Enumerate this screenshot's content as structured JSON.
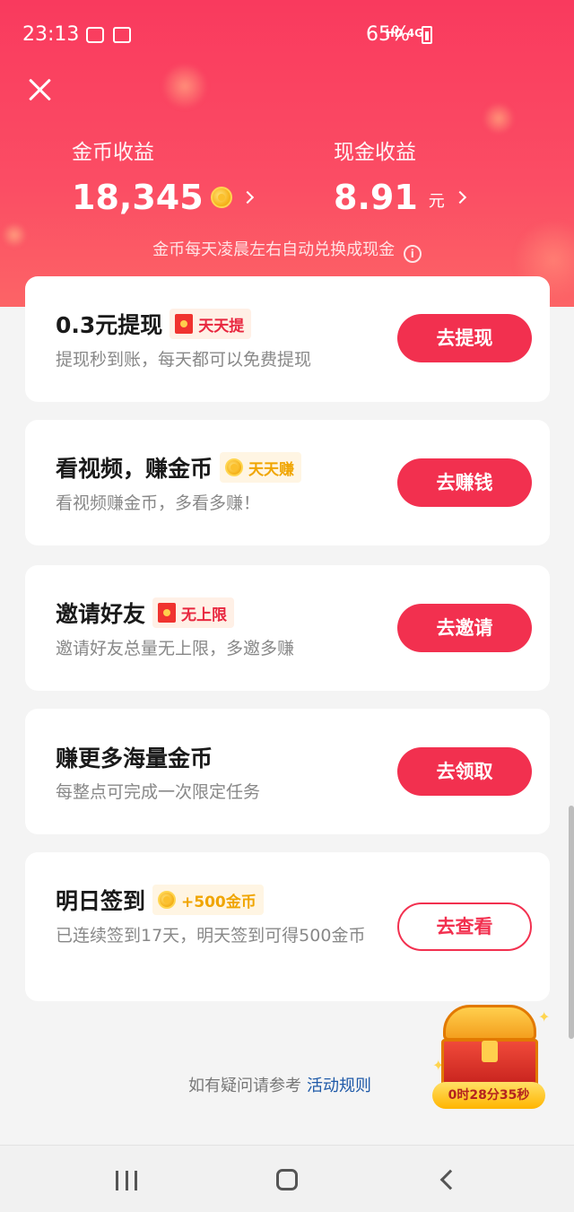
{
  "status_bar": {
    "time": "23:13",
    "network": "HD 4G",
    "battery": "65%"
  },
  "header": {
    "coin_label": "金币收益",
    "coin_value": "18,345",
    "cash_label": "现金收益",
    "cash_value": "8.91",
    "cash_unit": "元",
    "note": "金币每天凌晨左右自动兑换成现金",
    "colors": {
      "gradient_top": "#f93a5e",
      "gradient_bottom": "#fc6466"
    }
  },
  "tasks": [
    {
      "title": "0.3元提现",
      "tag": "天天提",
      "tag_icon": "red-envelope-icon",
      "desc": "提现秒到账，每天都可以免费提现",
      "button": "去提现",
      "button_style": "filled"
    },
    {
      "title": "看视频，赚金币",
      "tag": "天天赚",
      "tag_icon": "coin-icon",
      "desc": "看视频赚金币，多看多赚！",
      "button": "去赚钱",
      "button_style": "filled"
    },
    {
      "title": "邀请好友",
      "tag": "无上限",
      "tag_icon": "red-envelope-icon",
      "desc": "邀请好友总量无上限，多邀多赚",
      "button": "去邀请",
      "button_style": "filled"
    },
    {
      "title": "赚更多海量金币",
      "tag": "",
      "tag_icon": "",
      "desc": "每整点可完成一次限定任务",
      "button": "去领取",
      "button_style": "filled"
    },
    {
      "title": "明日签到",
      "tag": "+500金币",
      "tag_icon": "coin-icon",
      "desc": "已连续签到17天，明天签到可得500金币",
      "button": "去查看",
      "button_style": "outline"
    }
  ],
  "footer": {
    "prefix": "如有疑问请参考",
    "link": "活动规则"
  },
  "chest": {
    "timer": "0时28分35秒"
  },
  "accent_color": "#f2304f"
}
